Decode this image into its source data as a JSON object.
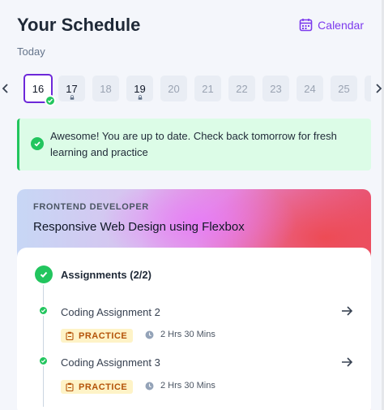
{
  "header": {
    "title": "Your Schedule",
    "calendar_label": "Calendar",
    "today_label": "Today"
  },
  "dates": [
    {
      "day": "16",
      "state": "selected-complete"
    },
    {
      "day": "17",
      "state": "has-task"
    },
    {
      "day": "18",
      "state": "empty"
    },
    {
      "day": "19",
      "state": "has-task"
    },
    {
      "day": "20",
      "state": "empty"
    },
    {
      "day": "21",
      "state": "empty"
    },
    {
      "day": "22",
      "state": "empty"
    },
    {
      "day": "23",
      "state": "empty"
    },
    {
      "day": "24",
      "state": "empty"
    },
    {
      "day": "25",
      "state": "empty"
    }
  ],
  "banner": {
    "message": "Awesome! You are up to date. Check back tomorrow for fresh learning and practice"
  },
  "course": {
    "role": "FRONTEND DEVELOPER",
    "title": "Responsive Web Design using Flexbox",
    "group_title": "Assignments (2/2)",
    "items": [
      {
        "title": "Coding Assignment 2",
        "tag": "PRACTICE",
        "duration": "2 Hrs 30 Mins"
      },
      {
        "title": "Coding Assignment 3",
        "tag": "PRACTICE",
        "duration": "2 Hrs 30 Mins"
      }
    ]
  },
  "colors": {
    "accent": "#7c3aed",
    "success": "#22c55e",
    "banner_bg": "#dcfce7",
    "tag_bg": "#fef3c7",
    "tag_text": "#b45309"
  },
  "icons": {
    "calendar": "calendar-icon",
    "prev": "chevron-left-icon",
    "next": "chevron-right-icon",
    "check": "check-icon",
    "lock": "lock-icon",
    "arrow": "arrow-right-icon",
    "clipboard": "clipboard-icon",
    "clock": "clock-icon"
  }
}
